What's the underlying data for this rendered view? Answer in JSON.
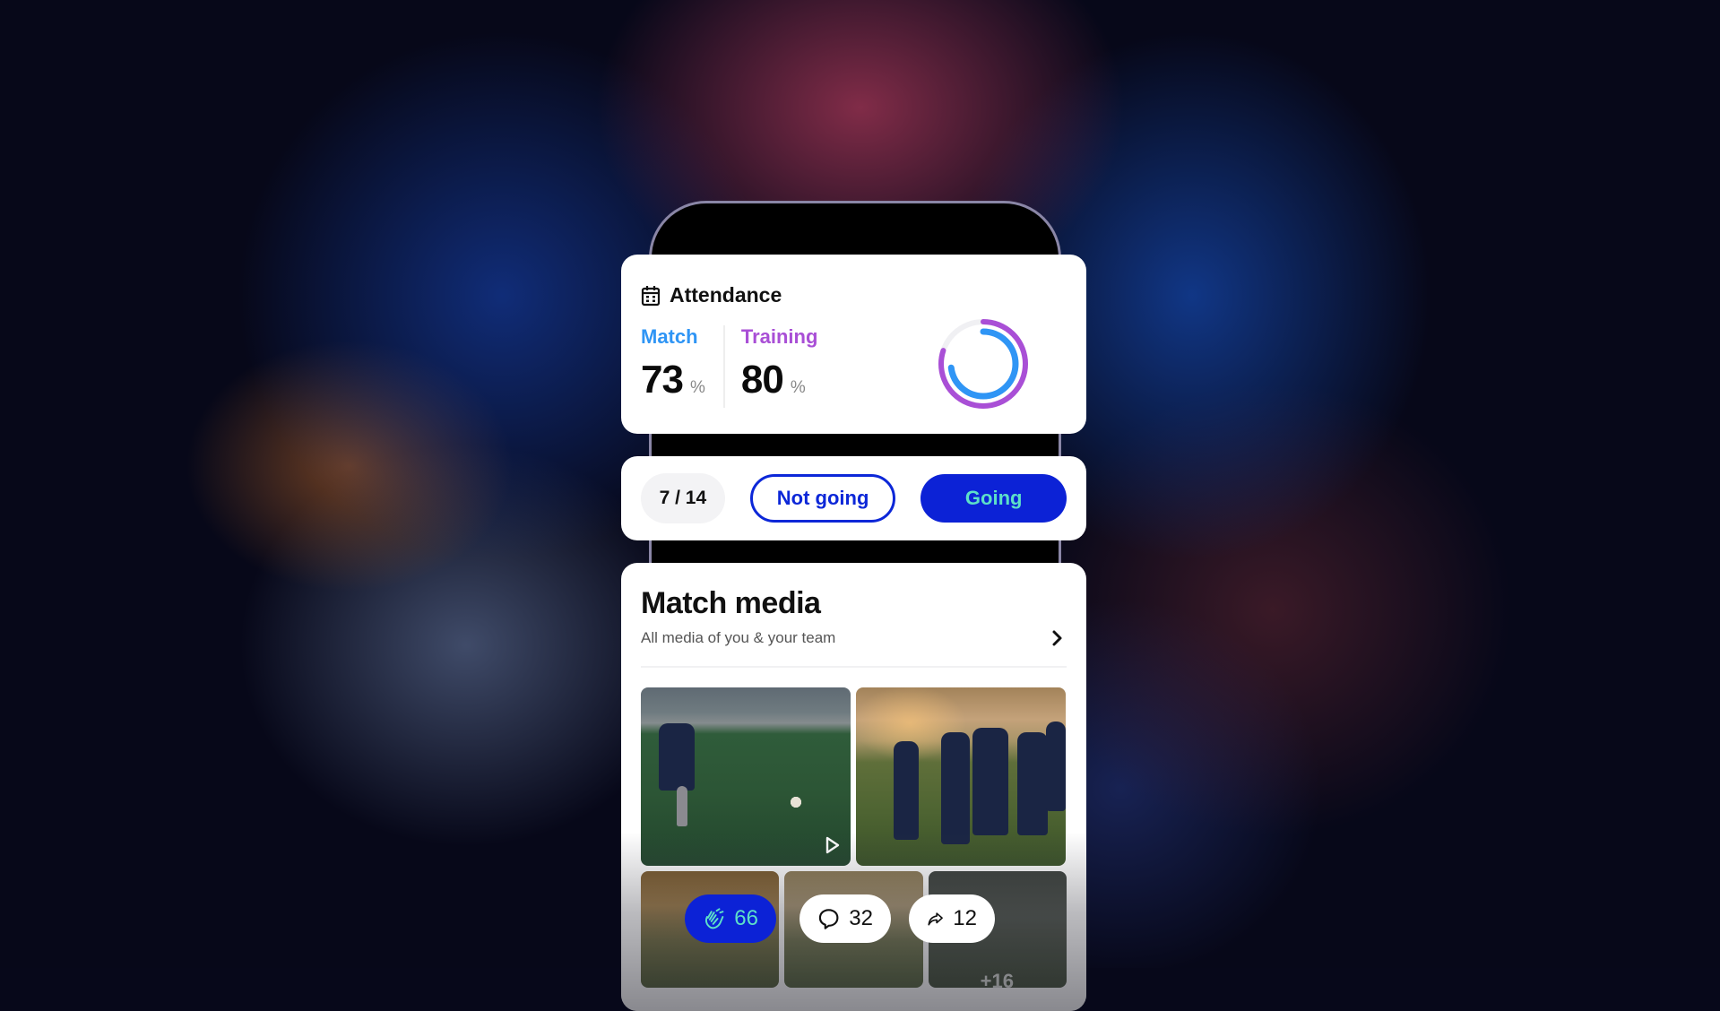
{
  "attendance": {
    "title": "Attendance",
    "match": {
      "label": "Match",
      "value": "73",
      "unit": "%",
      "fraction": 0.73,
      "color": "#2f95f5"
    },
    "training": {
      "label": "Training",
      "value": "80",
      "unit": "%",
      "fraction": 0.8,
      "color": "#a94fd6"
    }
  },
  "rsvp": {
    "count": "7 / 14",
    "not_going_label": "Not going",
    "going_label": "Going",
    "accent": "#0c22d6"
  },
  "media": {
    "title": "Match media",
    "subtitle": "All media of you & your team",
    "more_count": "+16",
    "reactions": {
      "claps": "66",
      "comments": "32",
      "shares": "12"
    }
  }
}
